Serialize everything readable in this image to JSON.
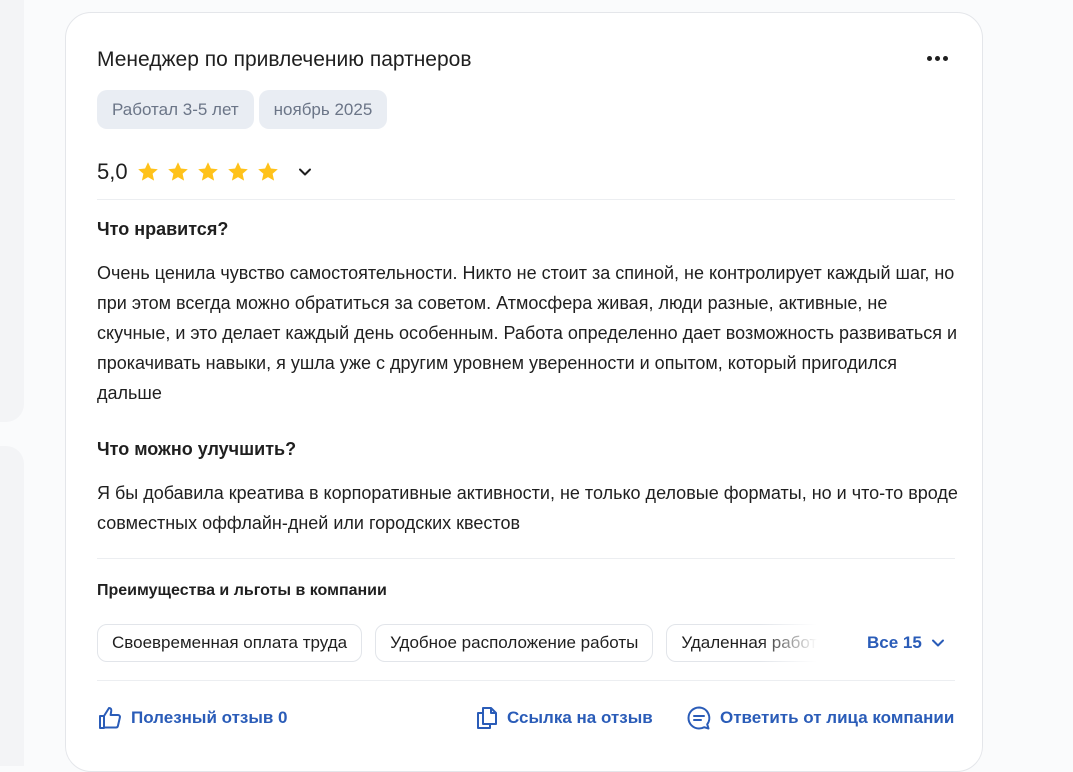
{
  "review": {
    "title": "Менеджер по привлечению партнеров",
    "tags": [
      "Работал 3-5 лет",
      "ноябрь 2025"
    ],
    "rating": "5,0",
    "stars": 5,
    "likes_title": "Что нравится?",
    "likes_text": "Очень ценила чувство самостоятельности. Никто не стоит за спиной, не контролирует каждый шаг, но при этом всегда можно обратиться за советом. Атмосфера живая, люди разные, активные, не скучные, и это делает каждый день особенным. Работа определенно дает возможность развиваться и прокачивать навыки, я ушла уже с другим уровнем уверенности и опытом, который пригодился дальше",
    "improve_title": "Что можно улучшить?",
    "improve_text": "Я бы добавила креатива в корпоративные активности, не только деловые форматы, но и что-то вроде совместных оффлайн-дней или городских квестов"
  },
  "benefits": {
    "title": "Преимущества и льготы в компании",
    "items": [
      "Своевременная оплата труда",
      "Удобное расположение работы",
      "Удаленная работа"
    ],
    "all_label": "Все 15"
  },
  "actions": {
    "helpful": "Полезный отзыв 0",
    "link": "Ссылка на отзыв",
    "reply": "Ответить от лица компании"
  },
  "colors": {
    "accent": "#2a5cb8",
    "star": "#ffc21a",
    "tag_bg": "#e9edf3",
    "tag_text": "#6b7587"
  },
  "icons": {
    "more": "more-horizontal-icon",
    "star": "star-icon",
    "toggle": "chevron-down-icon",
    "helpful": "thumbs-up-icon",
    "link": "copy-link-icon",
    "reply": "chat-bubble-icon"
  }
}
